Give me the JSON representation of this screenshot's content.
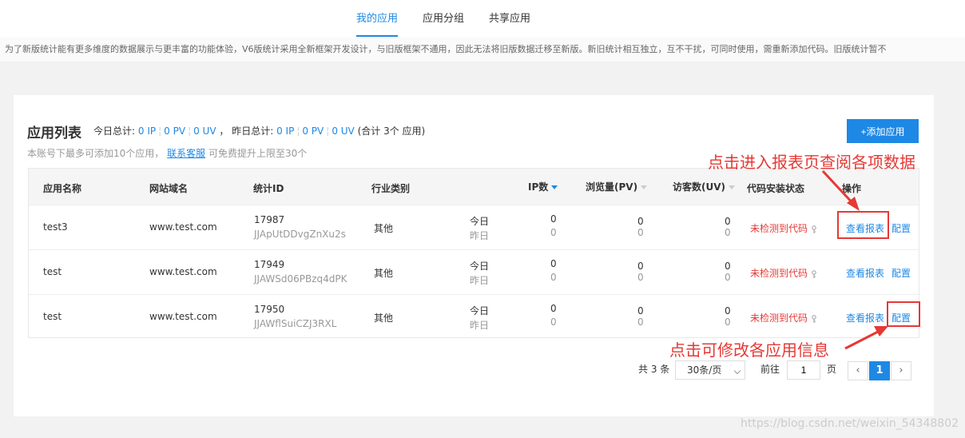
{
  "tabs": [
    {
      "label": "我的应用"
    },
    {
      "label": "应用分组"
    },
    {
      "label": "共享应用"
    }
  ],
  "notice": "为了新版统计能有更多维度的数据展示与更丰富的功能体验，V6版统计采用全新框架开发设计，与旧版框架不通用，因此无法将旧版数据迁移至新版。新旧统计相互独立，互不干扰，可同时使用，需重新添加代码。旧版统计暂不",
  "header": {
    "title": "应用列表",
    "today_label": "今日总计:",
    "today_ip": "0 IP",
    "today_pv": "0 PV",
    "today_uv": "0 UV",
    "yesterday_label": "，  昨日总计:",
    "yesterday_ip": "0 IP",
    "yesterday_pv": "0 PV",
    "yesterday_uv": "0 UV",
    "total": "(合计 3个 应用)",
    "sep": "¦",
    "sub_prefix": "本账号下最多可添加10个应用，",
    "sub_link": "联系客服",
    "sub_suffix": "可免费提升上限至30个",
    "add_button": "+添加应用"
  },
  "table": {
    "columns": [
      "应用名称",
      "网站域名",
      "统计ID",
      "行业类别",
      "IP数",
      "浏览量(PV)",
      "访客数(UV)",
      "代码安装状态",
      "操作"
    ],
    "rows": [
      {
        "name": "test3",
        "domain": "www.test.com",
        "id": "17987",
        "key": "JJApUtDDvgZnXu2s",
        "industry": "其他",
        "today": "今日",
        "yesterday": "昨日",
        "ip_t": "0",
        "ip_y": "0",
        "pv_t": "0",
        "pv_y": "0",
        "uv_t": "0",
        "uv_y": "0",
        "status": "未检测到代码",
        "action_report": "查看报表",
        "action_config": "配置"
      },
      {
        "name": "test",
        "domain": "www.test.com",
        "id": "17949",
        "key": "JJAWSd06PBzq4dPK",
        "industry": "其他",
        "today": "今日",
        "yesterday": "昨日",
        "ip_t": "0",
        "ip_y": "0",
        "pv_t": "0",
        "pv_y": "0",
        "uv_t": "0",
        "uv_y": "0",
        "status": "未检测到代码",
        "action_report": "查看报表",
        "action_config": "配置"
      },
      {
        "name": "test",
        "domain": "www.test.com",
        "id": "17950",
        "key": "JJAWflSuiCZJ3RXL",
        "industry": "其他",
        "today": "今日",
        "yesterday": "昨日",
        "ip_t": "0",
        "ip_y": "0",
        "pv_t": "0",
        "pv_y": "0",
        "uv_t": "0",
        "uv_y": "0",
        "status": "未检测到代码",
        "action_report": "查看报表",
        "action_config": "配置"
      }
    ]
  },
  "pager": {
    "total": "共 3 条",
    "page_size": "30条/页",
    "goto_label": "前往",
    "goto_value": "1",
    "page_unit": "页",
    "prev": "‹",
    "current": "1",
    "next": "›"
  },
  "annotations": {
    "top": "点击进入报表页查阅各项数据",
    "bottom": "点击可修改各应用信息"
  },
  "watermark": "https://blog.csdn.net/weixin_54348802",
  "colors": {
    "accent": "#1e88e5",
    "annotation": "#e53935"
  }
}
